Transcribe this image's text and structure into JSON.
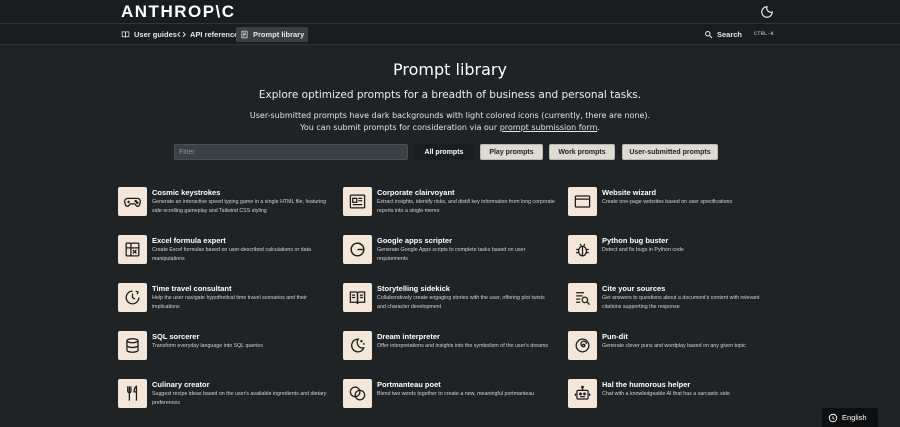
{
  "header": {
    "logo": "ANTHROP\\C",
    "theme_icon": "theme-toggle-icon"
  },
  "nav": {
    "items": [
      {
        "label": "User guides",
        "icon": "book-icon"
      },
      {
        "label": "API reference",
        "icon": "code-icon"
      },
      {
        "label": "Prompt library",
        "icon": "document-icon",
        "active": true
      }
    ],
    "search_label": "Search",
    "search_shortcut": "CTRL-K"
  },
  "main": {
    "title": "Prompt library",
    "subtitle": "Explore optimized prompts for a breadth of business and personal tasks.",
    "desc_line1": "User-submitted prompts have dark backgrounds with light colored icons (currently, there are none).",
    "desc_line2_pre": "You can submit prompts for consideration via our ",
    "desc_link": "prompt submission form",
    "desc_line2_post": "."
  },
  "filters": {
    "placeholder": "Filter",
    "buttons": [
      {
        "label": "All prompts",
        "active": true
      },
      {
        "label": "Play prompts",
        "active": false
      },
      {
        "label": "Work prompts",
        "active": false
      },
      {
        "label": "User-submitted prompts",
        "active": false
      }
    ]
  },
  "cards": [
    {
      "title": "Cosmic keystrokes",
      "desc": "Generate an interactive speed typing game in a single HTML file, featuring side-scrolling gameplay and Tailwind CSS styling",
      "icon": "gamepad-icon"
    },
    {
      "title": "Corporate clairvoyant",
      "desc": "Extract insights, identify risks, and distill key information from long corporate reports into a single memo",
      "icon": "report-icon"
    },
    {
      "title": "Website wizard",
      "desc": "Create one-page websites based on user specifications",
      "icon": "browser-window-icon"
    },
    {
      "title": "Excel formula expert",
      "desc": "Create Excel formulas based on user-described calculations or data manipulations",
      "icon": "spreadsheet-icon"
    },
    {
      "title": "Google apps scripter",
      "desc": "Generate Google Apps scripts to complete tasks based on user requirements",
      "icon": "google-g-icon"
    },
    {
      "title": "Python bug buster",
      "desc": "Detect and fix bugs in Python code",
      "icon": "bug-icon"
    },
    {
      "title": "Time travel consultant",
      "desc": "Help the user navigate hypothetical time travel scenarios and their implications",
      "icon": "clock-icon"
    },
    {
      "title": "Storytelling sidekick",
      "desc": "Collaboratively create engaging stories with the user, offering plot twists and character development",
      "icon": "open-book-icon"
    },
    {
      "title": "Cite your sources",
      "desc": "Get answers to questions about a document's content with relevant citations supporting the response",
      "icon": "document-search-icon"
    },
    {
      "title": "SQL sorcerer",
      "desc": "Transform everyday language into SQL queries",
      "icon": "database-icon"
    },
    {
      "title": "Dream interpreter",
      "desc": "Offer interpretations and insights into the symbolism of the user's dreams",
      "icon": "moon-stars-icon"
    },
    {
      "title": "Pun-dit",
      "desc": "Generate clever puns and wordplay based on any given topic",
      "icon": "spiral-icon"
    },
    {
      "title": "Culinary creator",
      "desc": "Suggest recipe ideas based on the user's available ingredients and dietary preferences",
      "icon": "utensils-icon"
    },
    {
      "title": "Portmanteau poet",
      "desc": "Blend two words together to create a new, meaningful portmanteau",
      "icon": "overlapping-circles-icon"
    },
    {
      "title": "Hal the humorous helper",
      "desc": "Chat with a knowledgeable AI that has a sarcastic side",
      "icon": "robot-icon"
    }
  ],
  "footer": {
    "language": "English"
  },
  "colors": {
    "background": "#1f2326",
    "topbar": "#1a1d1f",
    "icon_tile": "#f4e6d8",
    "icon_stroke": "#1b1b1b",
    "button_inactive": "#dedbd3"
  }
}
